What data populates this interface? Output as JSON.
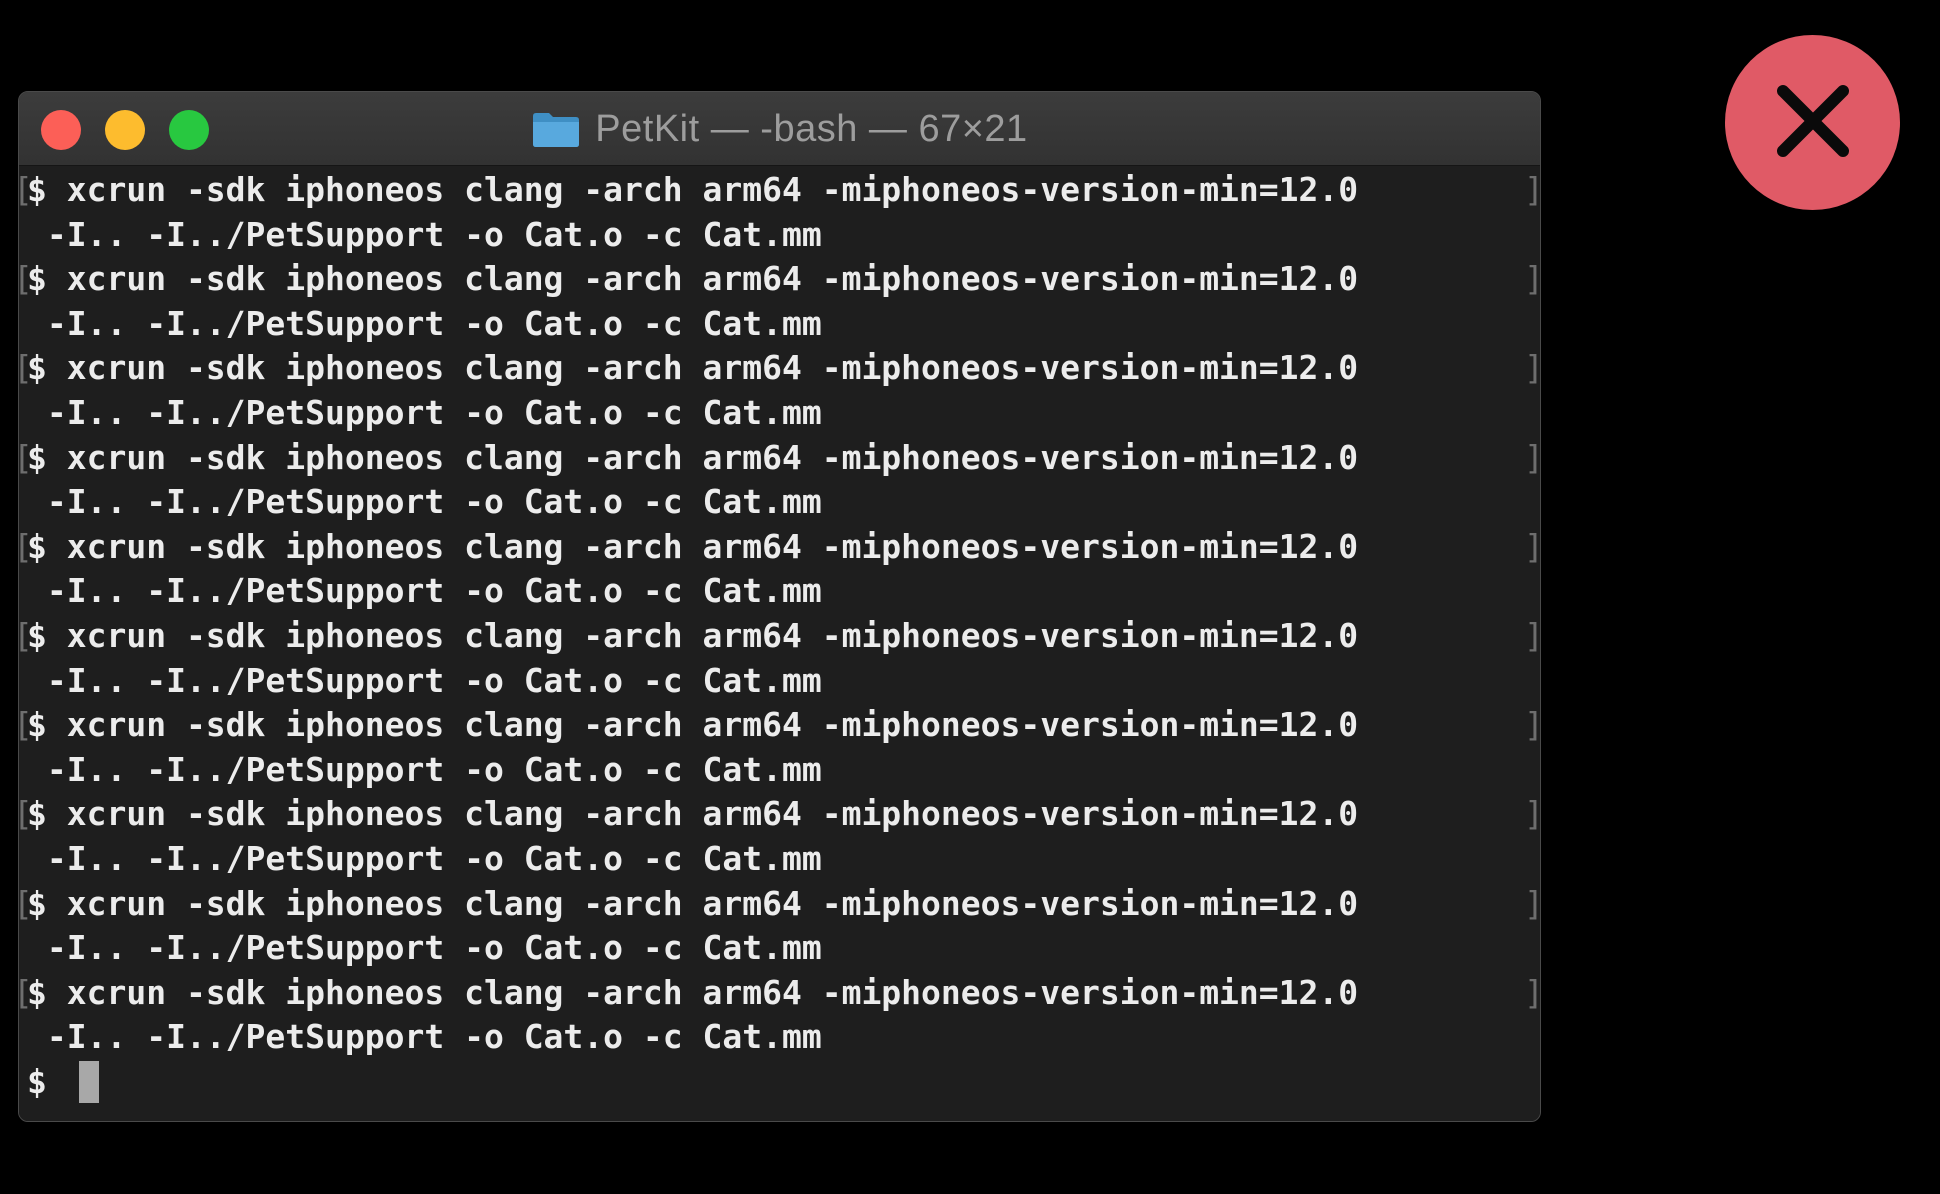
{
  "window": {
    "title": "PetKit — -bash — 67×21",
    "traffic_lights": {
      "close": "#fc5f57",
      "minimize": "#fdbc2e",
      "zoom": "#28c840"
    },
    "folder_icon": "folder-icon",
    "folder_color": "#58a9de"
  },
  "terminal": {
    "foreground": "#ececec",
    "background": "#1e1e1e",
    "commands": [
      {
        "line1": "$ xcrun -sdk iphoneos clang -arch arm64 -miphoneos-version-min=12.0",
        "line2": " -I.. -I../PetSupport -o Cat.o -c Cat.mm"
      },
      {
        "line1": "$ xcrun -sdk iphoneos clang -arch arm64 -miphoneos-version-min=12.0",
        "line2": " -I.. -I../PetSupport -o Cat.o -c Cat.mm"
      },
      {
        "line1": "$ xcrun -sdk iphoneos clang -arch arm64 -miphoneos-version-min=12.0",
        "line2": " -I.. -I../PetSupport -o Cat.o -c Cat.mm"
      },
      {
        "line1": "$ xcrun -sdk iphoneos clang -arch arm64 -miphoneos-version-min=12.0",
        "line2": " -I.. -I../PetSupport -o Cat.o -c Cat.mm"
      },
      {
        "line1": "$ xcrun -sdk iphoneos clang -arch arm64 -miphoneos-version-min=12.0",
        "line2": " -I.. -I../PetSupport -o Cat.o -c Cat.mm"
      },
      {
        "line1": "$ xcrun -sdk iphoneos clang -arch arm64 -miphoneos-version-min=12.0",
        "line2": " -I.. -I../PetSupport -o Cat.o -c Cat.mm"
      },
      {
        "line1": "$ xcrun -sdk iphoneos clang -arch arm64 -miphoneos-version-min=12.0",
        "line2": " -I.. -I../PetSupport -o Cat.o -c Cat.mm"
      },
      {
        "line1": "$ xcrun -sdk iphoneos clang -arch arm64 -miphoneos-version-min=12.0",
        "line2": " -I.. -I../PetSupport -o Cat.o -c Cat.mm"
      },
      {
        "line1": "$ xcrun -sdk iphoneos clang -arch arm64 -miphoneos-version-min=12.0",
        "line2": " -I.. -I../PetSupport -o Cat.o -c Cat.mm"
      },
      {
        "line1": "$ xcrun -sdk iphoneos clang -arch arm64 -miphoneos-version-min=12.0",
        "line2": " -I.. -I../PetSupport -o Cat.o -c Cat.mm"
      }
    ],
    "prompt": "$"
  },
  "overlay": {
    "close_icon": "close-x-icon",
    "close_color": "#e05a66"
  }
}
